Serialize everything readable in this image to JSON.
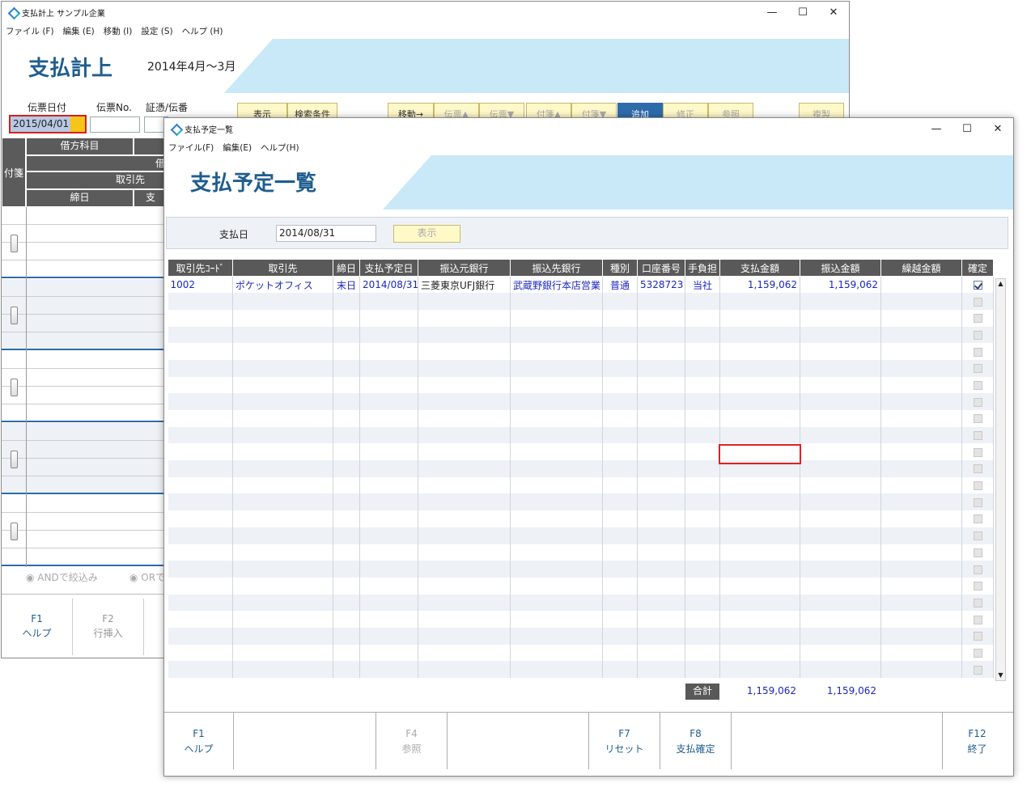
{
  "bg_window": {
    "title": "支払計上 サンプル企業",
    "menu": [
      "ファイル (F)",
      "編集 (E)",
      "移動 (I)",
      "設定 (S)",
      "ヘルプ (H)"
    ],
    "banner_title": "支払計上",
    "banner_sub": "2014年4月～3月",
    "labels": {
      "date": "伝票日付",
      "no": "伝票No.",
      "voucher": "証憑/伝番"
    },
    "date_value": "2015/04/01",
    "toolbar": [
      "表示",
      "検索条件",
      "移動→",
      "伝票▲",
      "伝票▼",
      "付箋▲",
      "付箋▼",
      "追加",
      "修正",
      "参照",
      "複製"
    ],
    "grid_headers": {
      "fusen": "付箋",
      "kamoku": "借方科目",
      "kashi": "借",
      "torihiki": "取引先",
      "shime": "締日",
      "col2": "支"
    },
    "filter": {
      "and": "ANDで絞込み",
      "or": "ORで"
    },
    "fkeys": [
      {
        "k": "F1",
        "l": "ヘルプ"
      },
      {
        "k": "F2",
        "l": "行挿入"
      }
    ]
  },
  "fg_window": {
    "title": "支払予定一覧",
    "menu": [
      "ファイル(F)",
      "編集(E)",
      "ヘルプ(H)"
    ],
    "banner_title": "支払予定一覧",
    "pay_date_label": "支払日",
    "pay_date_value": "2014/08/31",
    "show_button": "表示",
    "columns": [
      "取引先ｺｰﾄﾞ",
      "取引先",
      "締日",
      "支払予定日",
      "振込元銀行",
      "振込先銀行",
      "種別",
      "口座番号",
      "手負担",
      "支払金額",
      "振込金額",
      "繰越金額",
      "確定"
    ],
    "rows": [
      {
        "code": "1002",
        "name": "ポケットオフィス",
        "shime": "末日",
        "date": "2014/08/31",
        "from_bank": "三菱東京UFJ銀行",
        "to_bank": "武蔵野銀行本店営業",
        "kind": "普通",
        "account": "5328723",
        "fee": "当社",
        "pay": "1,159,062",
        "transfer": "1,159,062",
        "carry": "",
        "confirmed": true
      }
    ],
    "empty_rows": 23,
    "totals_label": "合計",
    "totals": {
      "pay": "1,159,062",
      "transfer": "1,159,062",
      "carry": ""
    },
    "fkeys": [
      {
        "k": "F1",
        "l": "ヘルプ",
        "enabled": true
      },
      {
        "k": "",
        "l": "",
        "enabled": true
      },
      {
        "k": "F4",
        "l": "参照",
        "enabled": false
      },
      {
        "k": "",
        "l": "",
        "enabled": true
      },
      {
        "k": "F7",
        "l": "リセット",
        "enabled": true
      },
      {
        "k": "F8",
        "l": "支払確定",
        "enabled": true
      },
      {
        "k": "",
        "l": "",
        "enabled": true
      },
      {
        "k": "F12",
        "l": "終了",
        "enabled": true
      }
    ]
  }
}
